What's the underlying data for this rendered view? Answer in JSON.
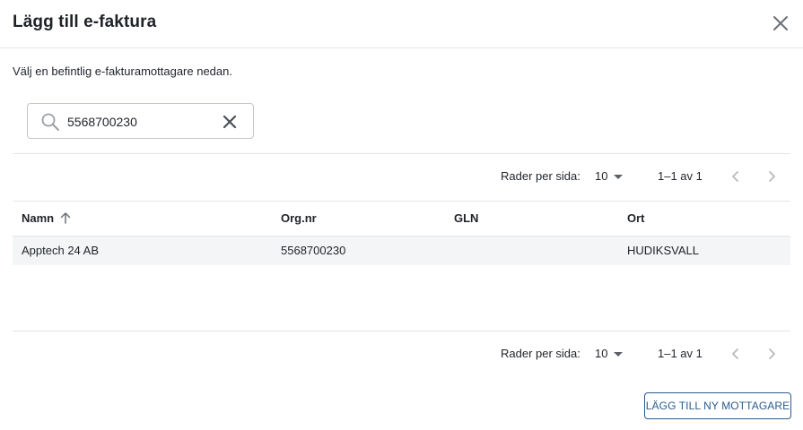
{
  "dialog": {
    "title": "Lägg till e-faktura",
    "subtitle": "Välj en befintlig e-fakturamottagare nedan."
  },
  "search": {
    "value": "5568700230",
    "placeholder": ""
  },
  "pagination_top": {
    "rows_label": "Rader per sida:",
    "rows_value": "10",
    "range": "1–1 av 1"
  },
  "pagination_bottom": {
    "rows_label": "Rader per sida:",
    "rows_value": "10",
    "range": "1–1 av 1"
  },
  "table": {
    "columns": [
      "Namn",
      "Org.nr",
      "GLN",
      "Ort"
    ],
    "sort": {
      "column": "Namn",
      "direction": "ascending"
    },
    "rows": [
      [
        "Apptech 24 AB",
        "5568700230",
        "",
        "HUDIKSVALL"
      ]
    ]
  },
  "actions": {
    "add_label": "LÄGG TILL NY MOTTAGARE"
  },
  "icons": {
    "close": "close-icon",
    "search": "search-icon",
    "clear": "clear-icon",
    "sort": "arrow-up-icon",
    "prev": "chevron-left-icon",
    "next": "chevron-right-icon"
  },
  "colors": {
    "primary": "#2a5c8c",
    "text": "#1f2329",
    "row_bg": "#f4f5f6",
    "border": "#e2e4e7"
  }
}
